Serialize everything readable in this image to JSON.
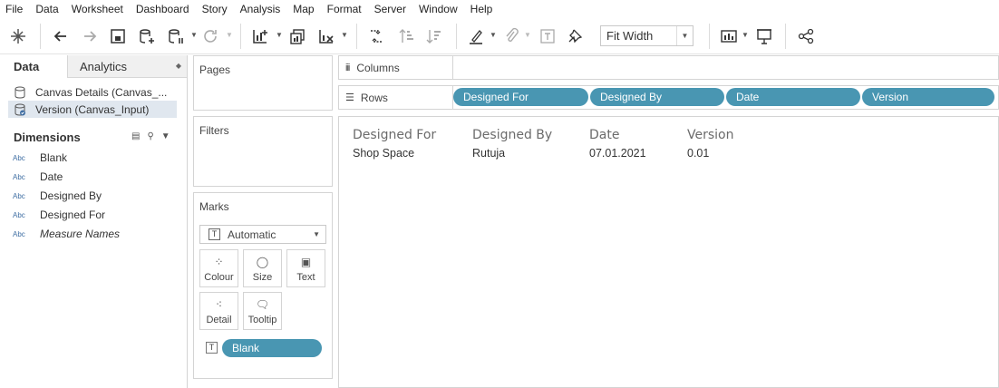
{
  "menu": [
    "File",
    "Data",
    "Worksheet",
    "Dashboard",
    "Story",
    "Analysis",
    "Map",
    "Format",
    "Server",
    "Window",
    "Help"
  ],
  "toolbar": {
    "fit_value": "Fit Width",
    "icons": [
      "tableau-logo-icon",
      "undo-icon",
      "redo-icon",
      "save-icon",
      "new-datasource-icon",
      "pause-updates-icon",
      "refresh-icon",
      "new-worksheet-icon",
      "duplicate-sheet-icon",
      "clear-sheet-icon",
      "swap-icon",
      "sort-ascending-icon",
      "sort-descending-icon",
      "highlight-icon",
      "group-icon",
      "labels-icon",
      "pin-icon",
      "show-me-icon",
      "presentation-icon",
      "share-icon"
    ]
  },
  "data_pane": {
    "tab_data": "Data",
    "tab_analytics": "Analytics",
    "datasources": [
      {
        "label": "Canvas Details (Canvas_...",
        "selected": false
      },
      {
        "label": "Version (Canvas_Input)",
        "selected": true
      }
    ],
    "dimensions_header": "Dimensions",
    "dimensions": [
      {
        "type": "Abc",
        "label": "Blank"
      },
      {
        "type": "Abc",
        "label": "Date"
      },
      {
        "type": "Abc",
        "label": "Designed By"
      },
      {
        "type": "Abc",
        "label": "Designed For"
      },
      {
        "type": "Abc",
        "label": "Measure Names"
      }
    ]
  },
  "cards": {
    "pages": "Pages",
    "filters": "Filters",
    "marks": "Marks",
    "mark_type": "Automatic",
    "buttons": [
      {
        "label": "Colour",
        "icon": "colour-icon"
      },
      {
        "label": "Size",
        "icon": "size-icon"
      },
      {
        "label": "Text",
        "icon": "text-icon"
      },
      {
        "label": "Detail",
        "icon": "detail-icon"
      },
      {
        "label": "Tooltip",
        "icon": "tooltip-icon"
      }
    ],
    "text_pill": "Blank"
  },
  "shelves": {
    "columns_label": "Columns",
    "rows_label": "Rows",
    "row_pills": [
      "Designed For",
      "Designed By",
      "Date",
      "Version"
    ]
  },
  "view": {
    "headers": [
      "Designed For",
      "Designed By",
      "Date",
      "Version"
    ],
    "row": [
      "Shop Space",
      "Rutuja",
      "07.01.2021",
      "0.01"
    ]
  },
  "colors": {
    "pill": "#4996b2",
    "selection": "#e0e7ef",
    "dimension_icon": "#3f6ea3"
  }
}
